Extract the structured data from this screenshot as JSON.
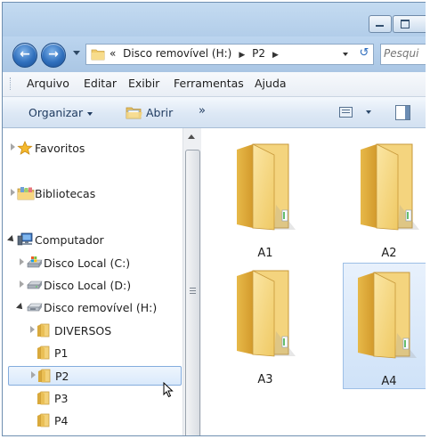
{
  "address": {
    "overflow": "«",
    "segments": [
      "Disco removível (H:)",
      "P2"
    ],
    "search_placeholder": "Pesqui"
  },
  "menu": [
    "Arquivo",
    "Editar",
    "Exibir",
    "Ferramentas",
    "Ajuda"
  ],
  "commands": {
    "organize": "Organizar",
    "open": "Abrir",
    "more": "»"
  },
  "tree": [
    {
      "label": "Favoritos",
      "expander": "closed",
      "icon": "star-icon"
    },
    {
      "label": "Bibliotecas",
      "expander": "closed",
      "icon": "libraries-icon"
    },
    {
      "label": "Computador",
      "expander": "open",
      "icon": "computer-icon"
    },
    {
      "label": "Disco Local (C:)",
      "expander": "closed",
      "icon": "system-drive-icon"
    },
    {
      "label": "Disco Local (D:)",
      "expander": "closed",
      "icon": "drive-icon"
    },
    {
      "label": "Disco removível (H:)",
      "expander": "open",
      "icon": "removable-drive-icon"
    },
    {
      "label": "DIVERSOS",
      "expander": "closed",
      "icon": "folder-icon"
    },
    {
      "label": "P1",
      "expander": "none",
      "icon": "folder-icon"
    },
    {
      "label": "P2",
      "expander": "closed",
      "icon": "folder-icon",
      "selected": true
    },
    {
      "label": "P3",
      "expander": "none",
      "icon": "folder-icon"
    },
    {
      "label": "P4",
      "expander": "none",
      "icon": "folder-icon"
    }
  ],
  "folders": [
    {
      "name": "A1"
    },
    {
      "name": "A2"
    },
    {
      "name": "A3"
    },
    {
      "name": "A4",
      "selected": true
    }
  ],
  "colors": {
    "chrome_blue": "#b2cde9",
    "selection": "#cfe2f8",
    "folder": "#f3d27a"
  }
}
